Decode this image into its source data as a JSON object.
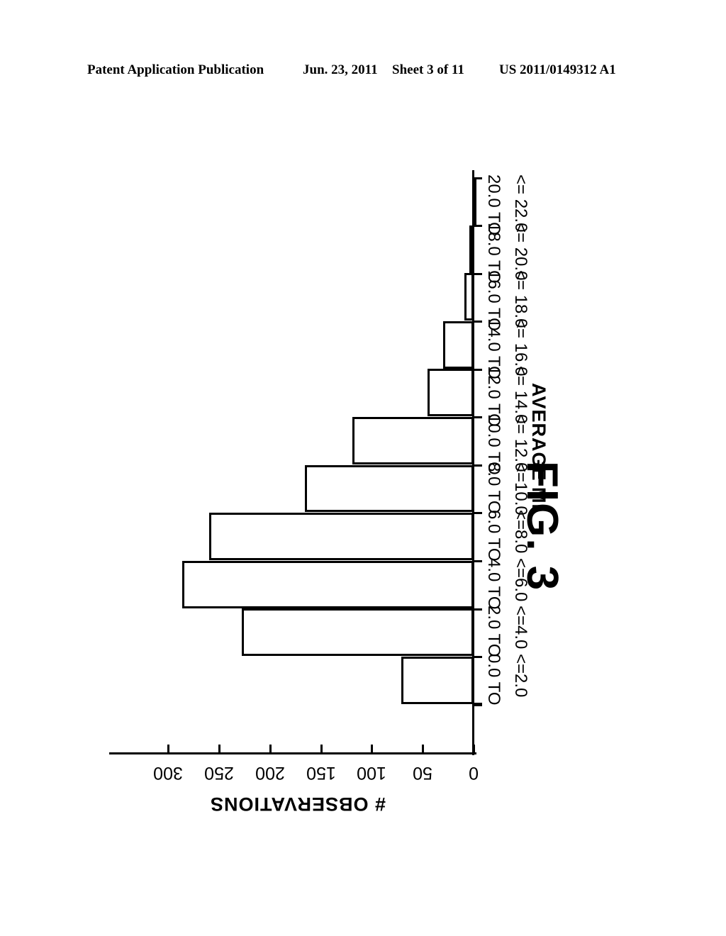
{
  "header": {
    "publication": "Patent Application Publication",
    "date": "Jun. 23, 2011",
    "sheet": "Sheet 3 of 11",
    "number": "US 2011/0149312 A1"
  },
  "figure": {
    "caption": "FIG. 3"
  },
  "chart_data": {
    "type": "bar",
    "orientation": "rotated-90-clockwise-histogram",
    "title": "",
    "xlabel": "AVERAGE MI",
    "ylabel": "# OBSERVATIONS",
    "categories": [
      "0.0 TO <=2.0",
      "2.0 TO <=4.0",
      "4.0 TO <=6.0",
      "6.0 TO <=8.0",
      "8.0 TO <=10.0",
      "10.0 TO <=12.0",
      "12.0 TO <=14.0",
      "14.0 TO <=16.0",
      "16.0 TO <=18.0",
      "18.0 TO <=20.0",
      "20.0 TO <=22.0"
    ],
    "category_lines": [
      [
        "0.0 TO",
        "<=2.0"
      ],
      [
        "2.0 TO",
        "<=4.0"
      ],
      [
        "4.0 TO",
        "<=6.0"
      ],
      [
        "6.0 TO",
        "<=8.0"
      ],
      [
        "8.0 TO",
        "<=10.0"
      ],
      [
        "10.0 TO",
        "<= 12.0"
      ],
      [
        "12.0 TO",
        "<= 14.0"
      ],
      [
        "14.0 TO",
        "<= 16.0"
      ],
      [
        "16.0 TO",
        "<= 18.0"
      ],
      [
        "18.0 TO",
        "<= 20.0"
      ],
      [
        "20.0 TO",
        "<= 22.0"
      ]
    ],
    "values": [
      71,
      228,
      286,
      260,
      166,
      119,
      45,
      30,
      9,
      4,
      1
    ],
    "ytick_labels": [
      "0",
      "50",
      "100",
      "150",
      "200",
      "250",
      "300"
    ],
    "ytick_values": [
      0,
      50,
      100,
      150,
      200,
      250,
      300
    ],
    "ylim": [
      0,
      320
    ],
    "grid": false,
    "legend": null
  }
}
